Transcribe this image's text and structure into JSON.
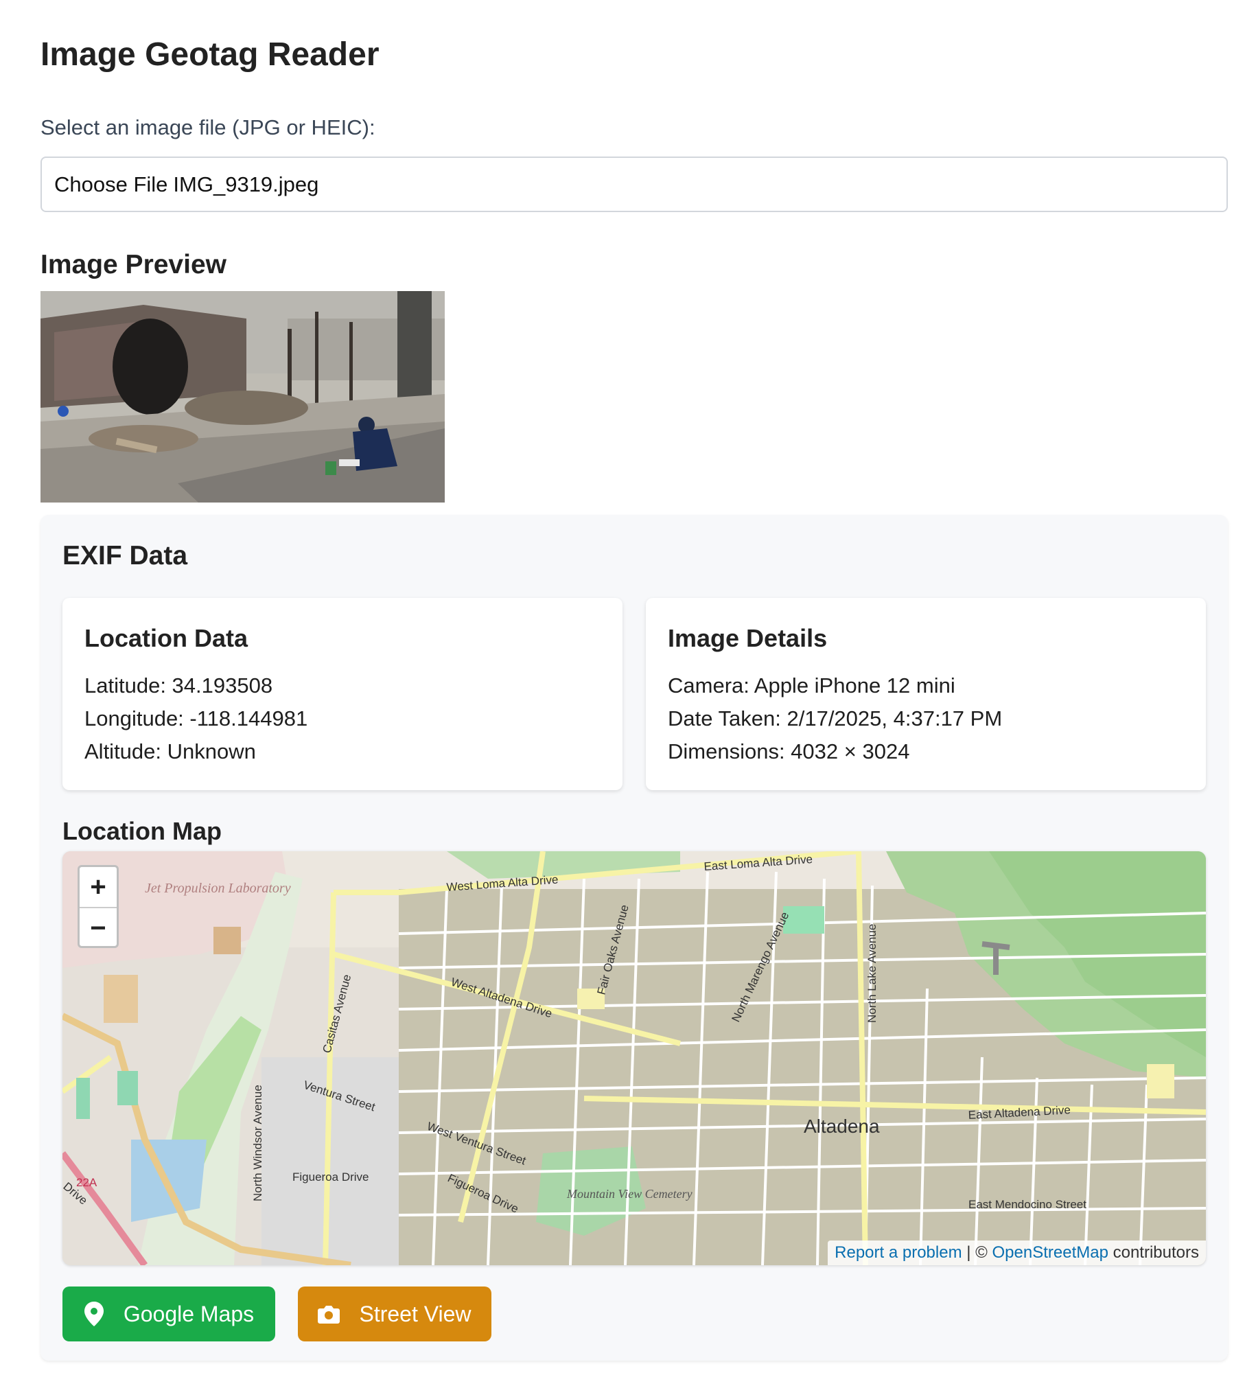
{
  "header": {
    "title": "Image Geotag Reader"
  },
  "file": {
    "label": "Select an image file (JPG or HEIC):",
    "choose_label": "Choose File",
    "filename": "IMG_9319.jpeg"
  },
  "preview": {
    "title": "Image Preview"
  },
  "exif": {
    "title": "EXIF Data",
    "location": {
      "title": "Location Data",
      "latitude": "Latitude: 34.193508",
      "longitude": "Longitude: -118.144981",
      "altitude": "Altitude: Unknown"
    },
    "details": {
      "title": "Image Details",
      "camera": "Camera: Apple iPhone 12 mini",
      "date": "Date Taken: 2/17/2025, 4:37:17 PM",
      "dimensions": "Dimensions: 4032 × 3024"
    },
    "map": {
      "title": "Location Map",
      "zoom_in": "+",
      "zoom_out": "−",
      "labels": {
        "jpl": "Jet Propulsion Laboratory",
        "west_loma_alta": "West Loma Alta Drive",
        "east_loma_alta": "East Loma Alta Drive",
        "fair_oaks": "Fair Oaks Avenue",
        "north_marengo": "North Marengo Avenue",
        "north_lake": "North Lake Avenue",
        "west_altadena": "West Altadena Drive",
        "casitas": "Casitas Avenue",
        "ventura": "Ventura Street",
        "west_ventura": "West Ventura Street",
        "north_windsor": "North Windsor Avenue",
        "figueroa": "Figueroa Drive",
        "figueroa2": "Figueroa Drive",
        "mountain_view": "Mountain View Cemetery",
        "altadena": "Altadena",
        "east_altadena": "East Altadena Drive",
        "east_mendocino": "East Mendocino Street",
        "hwy": "22A",
        "drive": "Drive"
      },
      "attribution": {
        "report": "Report a problem",
        "sep": " | © ",
        "osm": "OpenStreetMap",
        "contributors": " contributors"
      }
    },
    "buttons": {
      "google_maps": "Google Maps",
      "street_view": "Street View"
    }
  }
}
